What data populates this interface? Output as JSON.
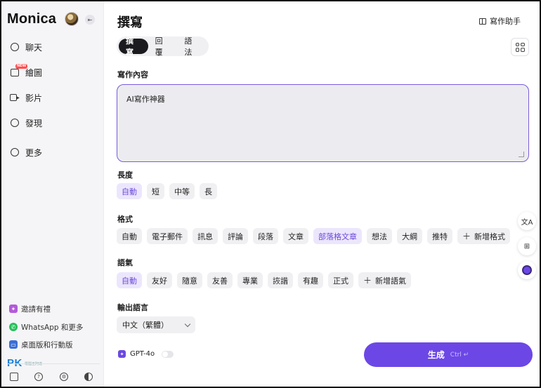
{
  "sidebar": {
    "brand": "Monica",
    "new_badge": "NEW",
    "nav": [
      {
        "label": "聊天",
        "icon": "chat-icon"
      },
      {
        "label": "繪圖",
        "icon": "image-icon"
      },
      {
        "label": "影片",
        "icon": "video-icon"
      },
      {
        "label": "發現",
        "icon": "compass-icon"
      },
      {
        "label": "更多",
        "icon": "plus-circle-icon"
      }
    ],
    "bottom_links": [
      {
        "label": "邀請有禮",
        "icon": "gift-icon"
      },
      {
        "label": "WhatsApp 和更多",
        "icon": "whatsapp-icon"
      },
      {
        "label": "桌面版和行動版",
        "icon": "devices-icon"
      }
    ],
    "watermark": "PK",
    "watermark_sub": "電腦王阿達"
  },
  "main": {
    "title": "撰寫",
    "assistant_label": "寫作助手",
    "tabs": [
      "撰寫",
      "回覆",
      "語法"
    ],
    "content_label": "寫作內容",
    "content_value": "AI寫作神器",
    "length": {
      "label": "長度",
      "options": [
        "自動",
        "短",
        "中等",
        "長"
      ]
    },
    "format": {
      "label": "格式",
      "options": [
        "自動",
        "電子郵件",
        "訊息",
        "評論",
        "段落",
        "文章",
        "部落格文章",
        "想法",
        "大綱",
        "推特"
      ],
      "add_label": "新增格式"
    },
    "tone": {
      "label": "語氣",
      "options": [
        "自動",
        "友好",
        "隨意",
        "友善",
        "專業",
        "詼諧",
        "有趣",
        "正式"
      ],
      "add_label": "新增語氣"
    },
    "output_language": {
      "label": "輸出語言",
      "value": "中文（繁體）"
    },
    "model": "GPT-4o",
    "generate_label": "生成",
    "generate_shortcut": "Ctrl ↵"
  },
  "colors": {
    "accent": "#6c47e6",
    "selected_chip_bg": "#ece6fd",
    "selected_chip_text": "#6a48d8"
  }
}
